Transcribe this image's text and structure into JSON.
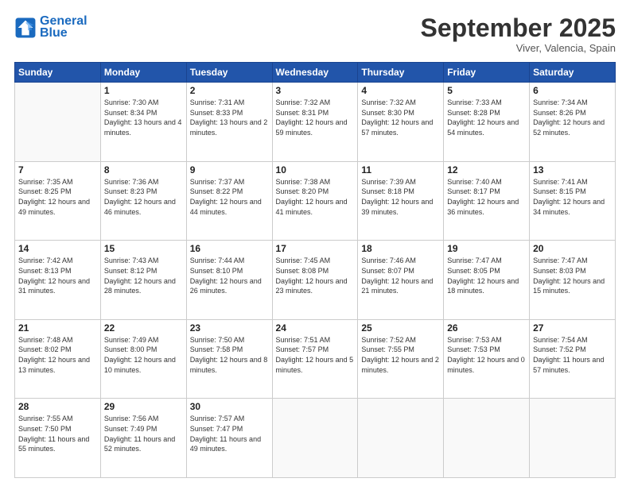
{
  "header": {
    "logo_line1": "General",
    "logo_line2": "Blue",
    "month": "September 2025",
    "location": "Viver, Valencia, Spain"
  },
  "weekdays": [
    "Sunday",
    "Monday",
    "Tuesday",
    "Wednesday",
    "Thursday",
    "Friday",
    "Saturday"
  ],
  "weeks": [
    [
      {
        "day": "",
        "sunrise": "",
        "sunset": "",
        "daylight": ""
      },
      {
        "day": "1",
        "sunrise": "Sunrise: 7:30 AM",
        "sunset": "Sunset: 8:34 PM",
        "daylight": "Daylight: 13 hours and 4 minutes."
      },
      {
        "day": "2",
        "sunrise": "Sunrise: 7:31 AM",
        "sunset": "Sunset: 8:33 PM",
        "daylight": "Daylight: 13 hours and 2 minutes."
      },
      {
        "day": "3",
        "sunrise": "Sunrise: 7:32 AM",
        "sunset": "Sunset: 8:31 PM",
        "daylight": "Daylight: 12 hours and 59 minutes."
      },
      {
        "day": "4",
        "sunrise": "Sunrise: 7:32 AM",
        "sunset": "Sunset: 8:30 PM",
        "daylight": "Daylight: 12 hours and 57 minutes."
      },
      {
        "day": "5",
        "sunrise": "Sunrise: 7:33 AM",
        "sunset": "Sunset: 8:28 PM",
        "daylight": "Daylight: 12 hours and 54 minutes."
      },
      {
        "day": "6",
        "sunrise": "Sunrise: 7:34 AM",
        "sunset": "Sunset: 8:26 PM",
        "daylight": "Daylight: 12 hours and 52 minutes."
      }
    ],
    [
      {
        "day": "7",
        "sunrise": "Sunrise: 7:35 AM",
        "sunset": "Sunset: 8:25 PM",
        "daylight": "Daylight: 12 hours and 49 minutes."
      },
      {
        "day": "8",
        "sunrise": "Sunrise: 7:36 AM",
        "sunset": "Sunset: 8:23 PM",
        "daylight": "Daylight: 12 hours and 46 minutes."
      },
      {
        "day": "9",
        "sunrise": "Sunrise: 7:37 AM",
        "sunset": "Sunset: 8:22 PM",
        "daylight": "Daylight: 12 hours and 44 minutes."
      },
      {
        "day": "10",
        "sunrise": "Sunrise: 7:38 AM",
        "sunset": "Sunset: 8:20 PM",
        "daylight": "Daylight: 12 hours and 41 minutes."
      },
      {
        "day": "11",
        "sunrise": "Sunrise: 7:39 AM",
        "sunset": "Sunset: 8:18 PM",
        "daylight": "Daylight: 12 hours and 39 minutes."
      },
      {
        "day": "12",
        "sunrise": "Sunrise: 7:40 AM",
        "sunset": "Sunset: 8:17 PM",
        "daylight": "Daylight: 12 hours and 36 minutes."
      },
      {
        "day": "13",
        "sunrise": "Sunrise: 7:41 AM",
        "sunset": "Sunset: 8:15 PM",
        "daylight": "Daylight: 12 hours and 34 minutes."
      }
    ],
    [
      {
        "day": "14",
        "sunrise": "Sunrise: 7:42 AM",
        "sunset": "Sunset: 8:13 PM",
        "daylight": "Daylight: 12 hours and 31 minutes."
      },
      {
        "day": "15",
        "sunrise": "Sunrise: 7:43 AM",
        "sunset": "Sunset: 8:12 PM",
        "daylight": "Daylight: 12 hours and 28 minutes."
      },
      {
        "day": "16",
        "sunrise": "Sunrise: 7:44 AM",
        "sunset": "Sunset: 8:10 PM",
        "daylight": "Daylight: 12 hours and 26 minutes."
      },
      {
        "day": "17",
        "sunrise": "Sunrise: 7:45 AM",
        "sunset": "Sunset: 8:08 PM",
        "daylight": "Daylight: 12 hours and 23 minutes."
      },
      {
        "day": "18",
        "sunrise": "Sunrise: 7:46 AM",
        "sunset": "Sunset: 8:07 PM",
        "daylight": "Daylight: 12 hours and 21 minutes."
      },
      {
        "day": "19",
        "sunrise": "Sunrise: 7:47 AM",
        "sunset": "Sunset: 8:05 PM",
        "daylight": "Daylight: 12 hours and 18 minutes."
      },
      {
        "day": "20",
        "sunrise": "Sunrise: 7:47 AM",
        "sunset": "Sunset: 8:03 PM",
        "daylight": "Daylight: 12 hours and 15 minutes."
      }
    ],
    [
      {
        "day": "21",
        "sunrise": "Sunrise: 7:48 AM",
        "sunset": "Sunset: 8:02 PM",
        "daylight": "Daylight: 12 hours and 13 minutes."
      },
      {
        "day": "22",
        "sunrise": "Sunrise: 7:49 AM",
        "sunset": "Sunset: 8:00 PM",
        "daylight": "Daylight: 12 hours and 10 minutes."
      },
      {
        "day": "23",
        "sunrise": "Sunrise: 7:50 AM",
        "sunset": "Sunset: 7:58 PM",
        "daylight": "Daylight: 12 hours and 8 minutes."
      },
      {
        "day": "24",
        "sunrise": "Sunrise: 7:51 AM",
        "sunset": "Sunset: 7:57 PM",
        "daylight": "Daylight: 12 hours and 5 minutes."
      },
      {
        "day": "25",
        "sunrise": "Sunrise: 7:52 AM",
        "sunset": "Sunset: 7:55 PM",
        "daylight": "Daylight: 12 hours and 2 minutes."
      },
      {
        "day": "26",
        "sunrise": "Sunrise: 7:53 AM",
        "sunset": "Sunset: 7:53 PM",
        "daylight": "Daylight: 12 hours and 0 minutes."
      },
      {
        "day": "27",
        "sunrise": "Sunrise: 7:54 AM",
        "sunset": "Sunset: 7:52 PM",
        "daylight": "Daylight: 11 hours and 57 minutes."
      }
    ],
    [
      {
        "day": "28",
        "sunrise": "Sunrise: 7:55 AM",
        "sunset": "Sunset: 7:50 PM",
        "daylight": "Daylight: 11 hours and 55 minutes."
      },
      {
        "day": "29",
        "sunrise": "Sunrise: 7:56 AM",
        "sunset": "Sunset: 7:49 PM",
        "daylight": "Daylight: 11 hours and 52 minutes."
      },
      {
        "day": "30",
        "sunrise": "Sunrise: 7:57 AM",
        "sunset": "Sunset: 7:47 PM",
        "daylight": "Daylight: 11 hours and 49 minutes."
      },
      {
        "day": "",
        "sunrise": "",
        "sunset": "",
        "daylight": ""
      },
      {
        "day": "",
        "sunrise": "",
        "sunset": "",
        "daylight": ""
      },
      {
        "day": "",
        "sunrise": "",
        "sunset": "",
        "daylight": ""
      },
      {
        "day": "",
        "sunrise": "",
        "sunset": "",
        "daylight": ""
      }
    ]
  ]
}
